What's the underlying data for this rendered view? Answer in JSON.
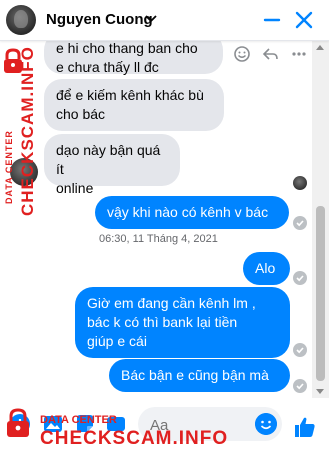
{
  "header": {
    "contact_name": "Nguyen Cuong"
  },
  "messages": [
    {
      "id": "m1",
      "direction": "in",
      "lines": [
        "e hi cho thang ban cho",
        "e chưa thấy ll đc"
      ]
    },
    {
      "id": "m2",
      "direction": "in",
      "lines": [
        "để e kiếm kênh khác bù",
        "cho bác"
      ]
    },
    {
      "id": "m3",
      "direction": "in",
      "lines": [
        "dạo này bận quá ít",
        "online"
      ]
    },
    {
      "id": "m4",
      "direction": "out",
      "lines": [
        "vậy khi nào có kênh v bác"
      ]
    },
    {
      "id": "m5",
      "direction": "out",
      "lines": [
        "Alo"
      ]
    },
    {
      "id": "m6",
      "direction": "out",
      "lines": [
        "Giờ em đang cần kênh lm ,",
        "bác k có thì bank lại tiền",
        "giúp e cái"
      ]
    },
    {
      "id": "m7",
      "direction": "out",
      "lines": [
        "Bác bận e cũng bận mà"
      ]
    }
  ],
  "timestamp": "06:30, 11 Tháng 4, 2021",
  "composer": {
    "placeholder": "Aa"
  },
  "watermark": {
    "small_text": "DATA CENTER",
    "big_text": "CHECKSCAM.INFO"
  },
  "colors": {
    "accent": "#0084ff",
    "incoming_bubble": "#e4e6eb",
    "watermark": "#e02020"
  },
  "icons": [
    "chevron-down-icon",
    "minimize-icon",
    "close-icon",
    "emoji-icon",
    "like-icon",
    "plus-icon",
    "image-icon",
    "sticker-icon",
    "gif-icon"
  ]
}
